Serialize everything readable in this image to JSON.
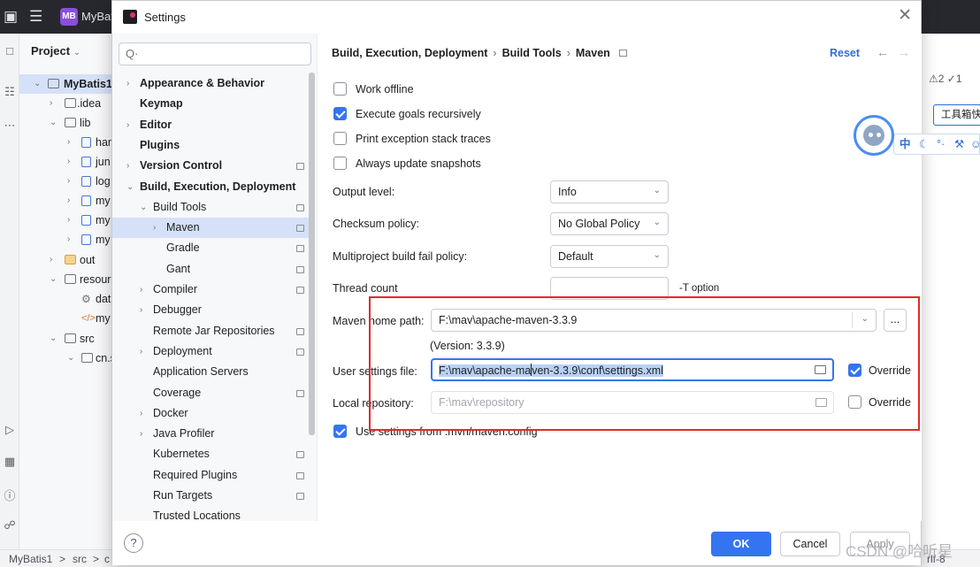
{
  "ide": {
    "project_name": "MyBat",
    "badge": "MB",
    "project_panel_title": "Project",
    "tree": [
      {
        "label": "MyBatis1",
        "bold": true
      },
      {
        "label": ".idea"
      },
      {
        "label": "lib"
      },
      {
        "label": "har"
      },
      {
        "label": "jun"
      },
      {
        "label": "log"
      },
      {
        "label": "my"
      },
      {
        "label": "my"
      },
      {
        "label": "my"
      },
      {
        "label": "out"
      },
      {
        "label": "resour"
      },
      {
        "label": "dat"
      },
      {
        "label": "my"
      },
      {
        "label": "src"
      },
      {
        "label": "cn.s"
      }
    ],
    "status_path": [
      "MyBatis1",
      ">",
      "src",
      ">",
      "c"
    ],
    "status_right": "rlf-8",
    "inspections": "⚠2 ✓1",
    "toolbox": "工具箱快",
    "ime": [
      "中",
      "☾",
      "°·",
      "⚒",
      "☺"
    ]
  },
  "dialog": {
    "title": "Settings",
    "search_placeholder": "Q·",
    "nav": [
      {
        "label": "Appearance & Behavior",
        "bold": true,
        "chevron": "›",
        "indent": 0
      },
      {
        "label": "Keymap",
        "bold": true,
        "chevron": "",
        "indent": 0
      },
      {
        "label": "Editor",
        "bold": true,
        "chevron": "›",
        "indent": 0
      },
      {
        "label": "Plugins",
        "bold": true,
        "chevron": "",
        "indent": 0
      },
      {
        "label": "Version Control",
        "bold": true,
        "chevron": "›",
        "indent": 0,
        "page": true
      },
      {
        "label": "Build, Execution, Deployment",
        "bold": true,
        "chevron": "⌄",
        "indent": 0
      },
      {
        "label": "Build Tools",
        "bold": false,
        "chevron": "⌄",
        "indent": 1,
        "page": true
      },
      {
        "label": "Maven",
        "bold": false,
        "chevron": "›",
        "indent": 2,
        "page": true,
        "selected": true
      },
      {
        "label": "Gradle",
        "bold": false,
        "chevron": "",
        "indent": 2,
        "page": true
      },
      {
        "label": "Gant",
        "bold": false,
        "chevron": "",
        "indent": 2,
        "page": true
      },
      {
        "label": "Compiler",
        "bold": false,
        "chevron": "›",
        "indent": 1,
        "page": true
      },
      {
        "label": "Debugger",
        "bold": false,
        "chevron": "›",
        "indent": 1
      },
      {
        "label": "Remote Jar Repositories",
        "bold": false,
        "chevron": "",
        "indent": 1,
        "page": true
      },
      {
        "label": "Deployment",
        "bold": false,
        "chevron": "›",
        "indent": 1,
        "page": true
      },
      {
        "label": "Application Servers",
        "bold": false,
        "chevron": "",
        "indent": 1
      },
      {
        "label": "Coverage",
        "bold": false,
        "chevron": "",
        "indent": 1,
        "page": true
      },
      {
        "label": "Docker",
        "bold": false,
        "chevron": "›",
        "indent": 1
      },
      {
        "label": "Java Profiler",
        "bold": false,
        "chevron": "›",
        "indent": 1
      },
      {
        "label": "Kubernetes",
        "bold": false,
        "chevron": "",
        "indent": 1,
        "page": true
      },
      {
        "label": "Required Plugins",
        "bold": false,
        "chevron": "",
        "indent": 1,
        "page": true
      },
      {
        "label": "Run Targets",
        "bold": false,
        "chevron": "",
        "indent": 1,
        "page": true
      },
      {
        "label": "Trusted Locations",
        "bold": false,
        "chevron": "",
        "indent": 1
      }
    ],
    "breadcrumb": [
      "Build, Execution, Deployment",
      "Build Tools",
      "Maven"
    ],
    "breadcrumb_sep": "›",
    "reset": "Reset",
    "nav_back": "←",
    "nav_forward": "→",
    "checkboxes": {
      "work_offline": {
        "label": "Work offline",
        "checked": false
      },
      "execute_recursively": {
        "label": "Execute goals recursively",
        "checked": true
      },
      "print_traces": {
        "label": "Print exception stack traces",
        "checked": false
      },
      "always_update": {
        "label": "Always update snapshots",
        "checked": false
      }
    },
    "output_level": {
      "label": "Output level:",
      "value": "Info"
    },
    "checksum_policy": {
      "label": "Checksum policy:",
      "value": "No Global Policy"
    },
    "multiproject_policy": {
      "label": "Multiproject build fail policy:",
      "value": "Default"
    },
    "thread_count": {
      "label": "Thread count",
      "value": "",
      "suffix": "-T option"
    },
    "maven_home": {
      "label": "Maven home path:",
      "value": "F:\\mav\\apache-maven-3.3.9",
      "browse": "...",
      "version": "(Version: 3.3.9)"
    },
    "user_settings": {
      "label": "User settings file:",
      "value_before_caret": "F:\\mav\\apache-ma",
      "value_after_caret": "ven-3.3.9\\conf\\settings.xml",
      "override_label": "Override",
      "override_checked": true
    },
    "local_repo": {
      "label": "Local repository:",
      "value": "F:\\mav\\repository",
      "override_label": "Override",
      "override_checked": false
    },
    "use_mvn_config": {
      "label": "Use settings from .mvn/maven.config",
      "checked": true
    },
    "buttons": {
      "help": "?",
      "ok": "OK",
      "cancel": "Cancel",
      "apply": "Apply"
    },
    "close": "✕"
  },
  "watermark": "CSDN @哈听星",
  "colors": {
    "accent": "#3574f0",
    "highlight_box": "#e5282e",
    "selection": "#d5e1f8"
  }
}
